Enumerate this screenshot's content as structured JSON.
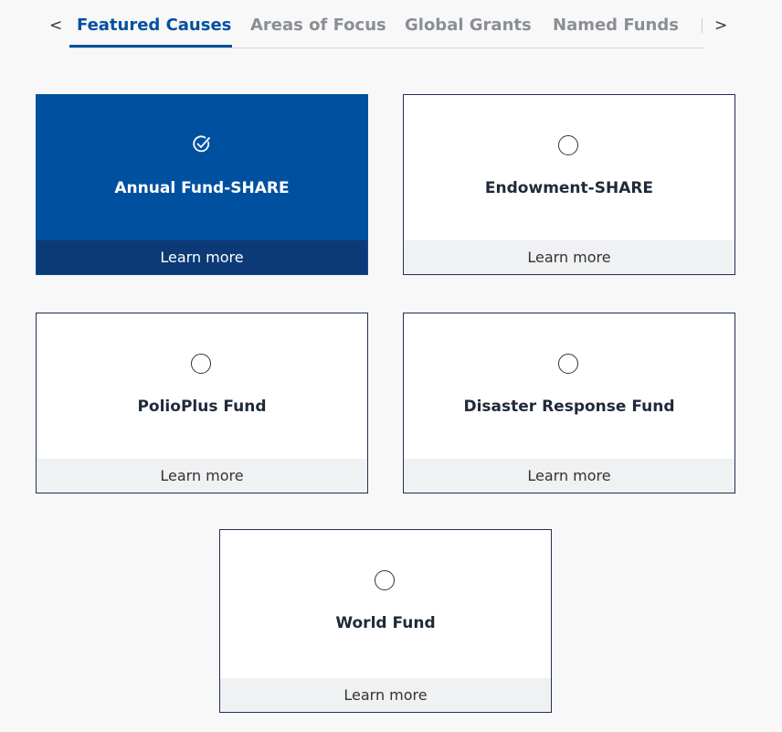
{
  "tabs": {
    "prev_arrow": "<",
    "next_arrow": ">",
    "items": [
      {
        "label": "Featured Causes",
        "active": true
      },
      {
        "label": "Areas of Focus",
        "active": false
      },
      {
        "label": "Global Grants",
        "active": false
      },
      {
        "label": "Named Funds",
        "active": false
      }
    ]
  },
  "colors": {
    "accent": "#0050a0",
    "selected_card_bg": "#0050a0",
    "selected_card_footer": "#0c3a76",
    "card_border": "#1f3150",
    "inactive_tab": "#8a8f95"
  },
  "cards": [
    {
      "title": "Annual Fund-SHARE",
      "link": "Learn more",
      "selected": true,
      "icon": "check-circle-icon"
    },
    {
      "title": "Endowment-SHARE",
      "link": "Learn more",
      "selected": false,
      "icon": "radio-empty-icon"
    },
    {
      "title": "PolioPlus Fund",
      "link": "Learn more",
      "selected": false,
      "icon": "radio-empty-icon"
    },
    {
      "title": "Disaster Response Fund",
      "link": "Learn more",
      "selected": false,
      "icon": "radio-empty-icon"
    },
    {
      "title": "World Fund",
      "link": "Learn more",
      "selected": false,
      "icon": "radio-empty-icon"
    }
  ]
}
